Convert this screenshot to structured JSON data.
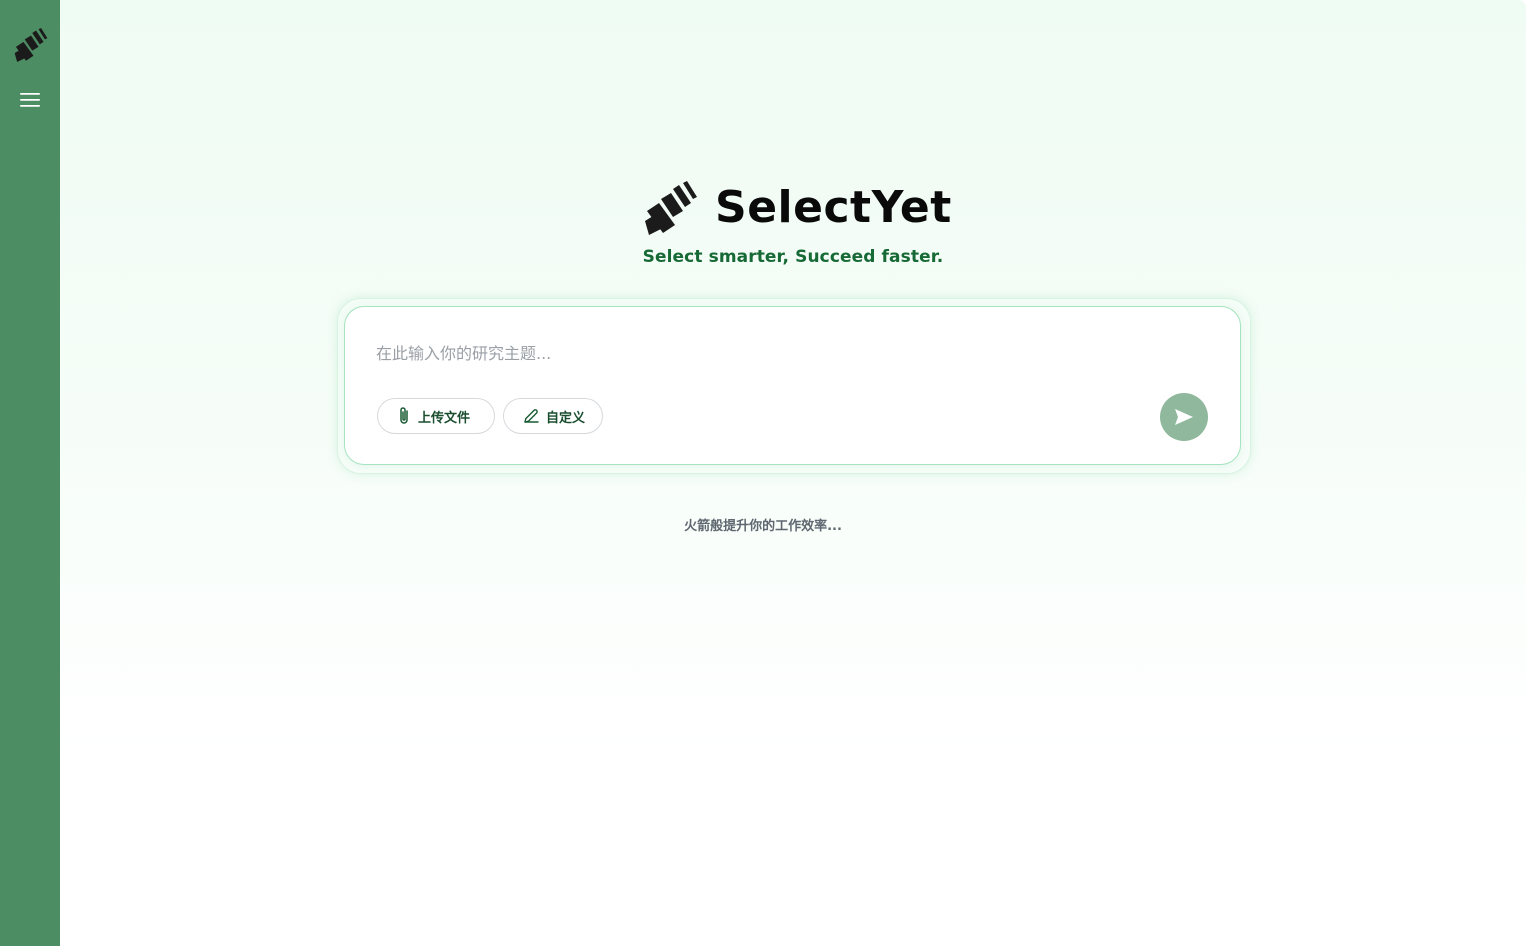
{
  "sidebar": {
    "logo_icon": "selectyet-logo-icon",
    "menu_icon": "hamburger-menu-icon"
  },
  "brand": {
    "name": "SelectYet",
    "tagline": "Select smarter, Succeed faster."
  },
  "search": {
    "placeholder": "在此输入你的研究主题...",
    "value": ""
  },
  "actions": {
    "upload_label": "上传文件",
    "upload_icon": "paperclip-icon",
    "custom_label": "自定义",
    "custom_icon": "pencil-icon",
    "send_icon": "send-arrow-icon"
  },
  "hint": "火箭般提升你的工作效率...",
  "colors": {
    "sidebar": "#4d8d63",
    "accent": "#176a35",
    "send_button": "#8fb89d",
    "background": "#effcf3"
  }
}
